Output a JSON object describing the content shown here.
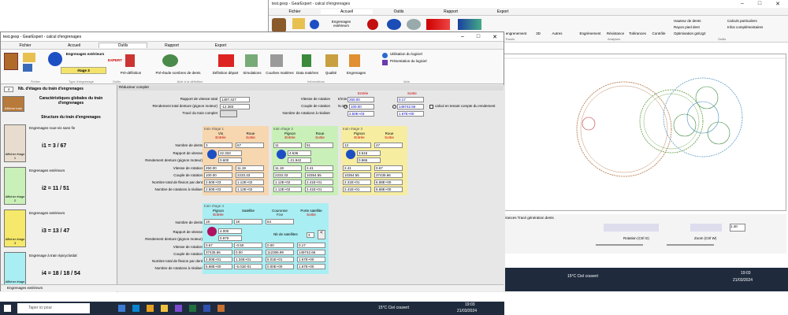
{
  "back_window": {
    "title": "test.gexp - GearExpert - calcul d'engrenages",
    "menu": [
      "Fichier",
      "Accueil",
      "Outils",
      "Rapport",
      "Export"
    ],
    "ribbon": {
      "items": [
        "Engrenages extérieurs",
        "engrenement",
        "3D",
        "Autres",
        "Engrènement",
        "Résistance",
        "Tolérances",
        "Contrôle"
      ],
      "right_items": [
        "Hauteur de dents",
        "Rayon pied dent",
        "Optimisation gs/Ug2",
        "Calculs particuliers",
        "Infos complémentaires"
      ],
      "sections": [
        "Tracés",
        "Analyses",
        "Outils"
      ]
    },
    "bottom_tabs": "olérances  Tracé génération dents",
    "rotation_label": "Rotation  (Ctrl G)",
    "zoom_label": "Zoom  (Ctrl W)",
    "zoom_value": "1.40",
    "taskbar": {
      "weather": "15°C  Ciel couvert",
      "time": "19:03",
      "date": "21/03/2024"
    }
  },
  "window": {
    "title": "test.gexp - GearExpert - calcul d'engrenages",
    "menu": [
      "Fichier",
      "Accueil",
      "Outils",
      "Rapport",
      "Export"
    ],
    "ribbon": {
      "stage_label": "étage 3",
      "gear_type": "Engrenages extérieurs",
      "expert": "EXPERT",
      "items": [
        "Pré-définition",
        "Pré-étude nombres de dents",
        "Définition départ",
        "Simulations",
        "Courbes matières",
        "Data matières",
        "Qualité",
        "Engrenages"
      ],
      "info": [
        "Utilisation du logiciel",
        "Présentation du logiciel"
      ],
      "sections": [
        "Fichier",
        "Type d'engrenage",
        "Outils",
        "Aide à la définition",
        "Informations",
        "Aide"
      ]
    }
  },
  "left_panel": {
    "nb_stages_value": "4",
    "nb_stages_label": "Nb. d'étages du train d'engrenages",
    "global_label": "Caractéristiques globales du train d'engrenages",
    "structure_label": "Structure du train d'engrenages",
    "afficher_train": "Afficher train",
    "stages": [
      {
        "type": "Engrenages roue-vis sans fin",
        "ratio": "i1 = 3 / 67",
        "btn": "Afficher étage 1"
      },
      {
        "type": "Engrenages extérieurs",
        "ratio": "i2 = 11 / 51",
        "btn": "Afficher étage 2"
      },
      {
        "type": "Engrenages extérieurs",
        "ratio": "i3 = 13 / 47",
        "btn": "Afficher étage 3"
      },
      {
        "type": "Engrenage à train épicycloïdal",
        "ratio": "i4 = 18 / 18 / 54",
        "btn": "Afficher étage 4"
      }
    ],
    "status": "Engrenages extérieurs"
  },
  "main": {
    "header": "Réducteur complet",
    "global": {
      "ratio_label": "Rapport de vitesse total",
      "ratio": "1497.427",
      "eff_label": "Rendement total denture (pignon moteur)",
      "eff": "-12.383",
      "trace_label": "Tracé du train complet",
      "entree": "Entrée",
      "sortie": "Sortie",
      "speed_label": "Vitesse de rotation",
      "speed_unit": "tr/min",
      "speed_in": "250.00",
      "speed_out": "0.17",
      "torque_label": "Couple de rotation",
      "torque_unit": "N.mm",
      "torque_in": "100.00",
      "torque_out": "149742.66",
      "rot_label": "Nombre de rotations à réaliser",
      "rot_in": "2.50E+03",
      "rot_out": "1.67E+00",
      "calc_label": "calcul en tenant compte du rendement"
    },
    "row_labels": [
      "Nombre de dents",
      "Rapport de vitesse",
      "Rendement denture (pignon moteur)",
      "Vitesse de rotation",
      "Couple de rotation",
      "Nombre total de flexion par dent",
      "Nombre de rotations à réaliser"
    ],
    "stage1": {
      "title": "train étage 1",
      "c1": "Vis",
      "c2": "Roue",
      "e": "Entrée",
      "s": "Sortie",
      "teeth": [
        "3",
        "67"
      ],
      "ratio": "22.333",
      "eff": "0.600",
      "speed": [
        "250.00",
        "11.19"
      ],
      "torque": [
        "100.00",
        "2233.33"
      ],
      "flex": [
        "2.50E+03",
        "1.12E+02"
      ],
      "rot": [
        "2.50E+03",
        "1.12E+02"
      ]
    },
    "stage2": {
      "title": "train étage 2",
      "c1": "Pignon",
      "c2": "Roue",
      "e": "Entrée",
      "s": "Sortie",
      "teeth": [
        "11",
        "51"
      ],
      "ratio": "4.636",
      "eff": "-21.942",
      "speed": [
        "11.19",
        "2.41"
      ],
      "torque": [
        "2233.33",
        "10354.55"
      ],
      "flex": [
        "1.12E+02",
        "2.41E+01"
      ],
      "rot": [
        "1.12E+02",
        "2.41E+01"
      ]
    },
    "stage3": {
      "title": "train étage 3",
      "c1": "Pignon",
      "c2": "Roue",
      "e": "Entrée",
      "s": "Sortie",
      "teeth": [
        "13",
        "47"
      ],
      "ratio": "3.615",
      "eff": "0.965",
      "speed": [
        "2.41",
        "0.67"
      ],
      "torque": [
        "10354.55",
        "37435.66"
      ],
      "flex": [
        "2.41E+01",
        "6.68E+00"
      ],
      "rot": [
        "2.41E+01",
        "6.68E+00"
      ]
    },
    "stage4": {
      "title": "train étage 4",
      "c1": "Pignon",
      "c2": "Satellite",
      "c3": "Couronne",
      "c4": "Porte satellite",
      "e": "Entrée",
      "f": "Fixe",
      "s": "Sortie",
      "teeth": [
        "18",
        "18",
        "54"
      ],
      "ratio": "4.000",
      "eff": "0.970",
      "nsat_label": "Nb de satellites",
      "nsat": "3",
      "speed": [
        "0.67",
        "-0.50",
        "0.00",
        "0.17"
      ],
      "torque": [
        "37435.66",
        "0.00",
        "112306.99",
        "149742.66"
      ],
      "flex": [
        "2.00E+01",
        "1.34E+01",
        "8.01E+01",
        "1.67E+00"
      ],
      "rot": [
        "6.68E+00",
        "-5.01E-01",
        "0.00E+00",
        "1.67E+00"
      ]
    }
  },
  "taskbar": {
    "search": "Taper ici pour",
    "weather": "15°C  Ciel couvert",
    "time": "19:03",
    "date": "21/03/2024"
  },
  "colors": {
    "stage1": "#f6d7b0",
    "stage2": "#c9f0b8",
    "stage3": "#f6eda0",
    "stage4": "#a9eef2",
    "left_bg": "#f0f0f0"
  }
}
